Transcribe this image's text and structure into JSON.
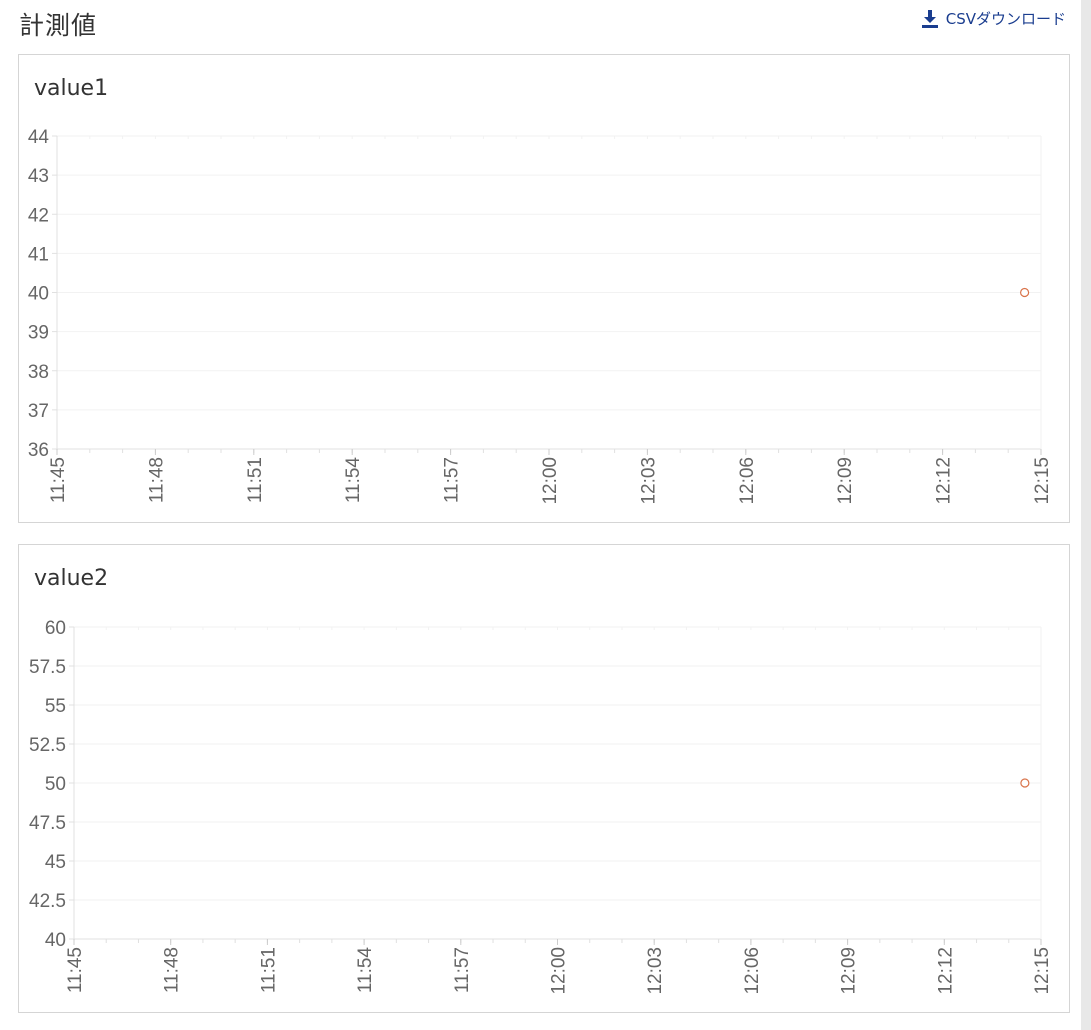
{
  "header": {
    "title": "計測値",
    "csv_label": "CSVダウンロード"
  },
  "colors": {
    "point": "#d9734a",
    "grid": "#f2f2f2",
    "axis": "#e0e0e0",
    "link": "#1a3d8f"
  },
  "chart_data": [
    {
      "type": "scatter",
      "title": "value1",
      "x_ticks": [
        "11:45",
        "11:48",
        "11:51",
        "11:54",
        "11:57",
        "12:00",
        "12:03",
        "12:06",
        "12:09",
        "12:12",
        "12:15"
      ],
      "xlim": [
        "11:45",
        "12:15"
      ],
      "y_ticks": [
        "36",
        "37",
        "38",
        "39",
        "40",
        "41",
        "42",
        "43",
        "44"
      ],
      "ylim": [
        36,
        44
      ],
      "points": [
        {
          "x": "12:14:30",
          "y": 40
        }
      ]
    },
    {
      "type": "scatter",
      "title": "value2",
      "x_ticks": [
        "11:45",
        "11:48",
        "11:51",
        "11:54",
        "11:57",
        "12:00",
        "12:03",
        "12:06",
        "12:09",
        "12:12",
        "12:15"
      ],
      "xlim": [
        "11:45",
        "12:15"
      ],
      "y_ticks": [
        "40",
        "42.5",
        "45",
        "47.5",
        "50",
        "52.5",
        "55",
        "57.5",
        "60"
      ],
      "ylim": [
        40,
        60
      ],
      "points": [
        {
          "x": "12:14:30",
          "y": 50
        }
      ]
    }
  ]
}
